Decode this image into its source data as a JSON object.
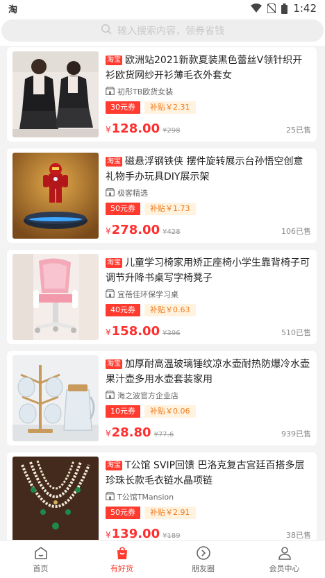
{
  "status_bar": {
    "app_glyph": "淘",
    "time": "1:42",
    "icons": [
      "wifi-icon",
      "no-sim-icon",
      "battery-icon"
    ]
  },
  "search": {
    "placeholder": "输入搜索内容，领券省钱",
    "icon": "search-icon"
  },
  "badge_label": "淘宝",
  "products": [
    {
      "title": "欧洲站2021新款夏装黑色蕾丝V领针织开衫欧货网纱开衫薄毛衣外套女",
      "shop": "初彤TB欧货女装",
      "coupon": "30元券",
      "subsidy": "补贴￥2.31",
      "price_symbol": "¥",
      "price": "128.00",
      "original_price": "¥298",
      "sold": "25已售",
      "image": "black-lace-cardigan"
    },
    {
      "title": "磁悬浮钢铁侠 摆件旋转展示台孙悟空创意礼物手办玩具DIY展示架",
      "shop": "极客精选",
      "coupon": "50元券",
      "subsidy": "补贴￥1.73",
      "price_symbol": "¥",
      "price": "278.00",
      "original_price": "¥428",
      "sold": "106已售",
      "image": "levitating-iron-man"
    },
    {
      "title": "儿童学习椅家用矫正座椅小学生靠背椅子可调节升降书桌写字椅凳子",
      "shop": "宜蓓佳环保学习桌",
      "coupon": "40元券",
      "subsidy": "补贴￥0.63",
      "price_symbol": "¥",
      "price": "158.00",
      "original_price": "¥396",
      "sold": "510已售",
      "image": "pink-kids-chair"
    },
    {
      "title": "加厚耐高温玻璃锤纹凉水壶耐热防爆冷水壶果汁壶多用水壶套装家用",
      "shop": "海之波官方企业店",
      "coupon": "10元券",
      "subsidy": "补贴￥0.06",
      "price_symbol": "¥",
      "price": "28.80",
      "original_price": "¥77.6",
      "sold": "939已售",
      "image": "glass-jug-set"
    },
    {
      "title": "T公馆 SVIP回馈 巴洛克复古宫廷百搭多层珍珠长款毛衣链水晶项链",
      "shop": "T公馆TMansion",
      "coupon": "50元券",
      "subsidy": "补贴￥2.91",
      "price_symbol": "¥",
      "price": "139.00",
      "original_price": "¥189",
      "sold": "38已售",
      "image": "pearl-necklace"
    }
  ],
  "bottom_nav": [
    {
      "label": "首页",
      "icon": "home-icon",
      "active": false
    },
    {
      "label": "有好货",
      "icon": "shopping-bag-icon",
      "active": true
    },
    {
      "label": "朋友圈",
      "icon": "circle-arrow-icon",
      "active": false
    },
    {
      "label": "会员中心",
      "icon": "user-icon",
      "active": false
    }
  ],
  "colors": {
    "accent": "#ff3a2f",
    "subsidy_text": "#f07a1a",
    "subsidy_bg": "#fff3e0",
    "price": "#ff2f2f"
  }
}
